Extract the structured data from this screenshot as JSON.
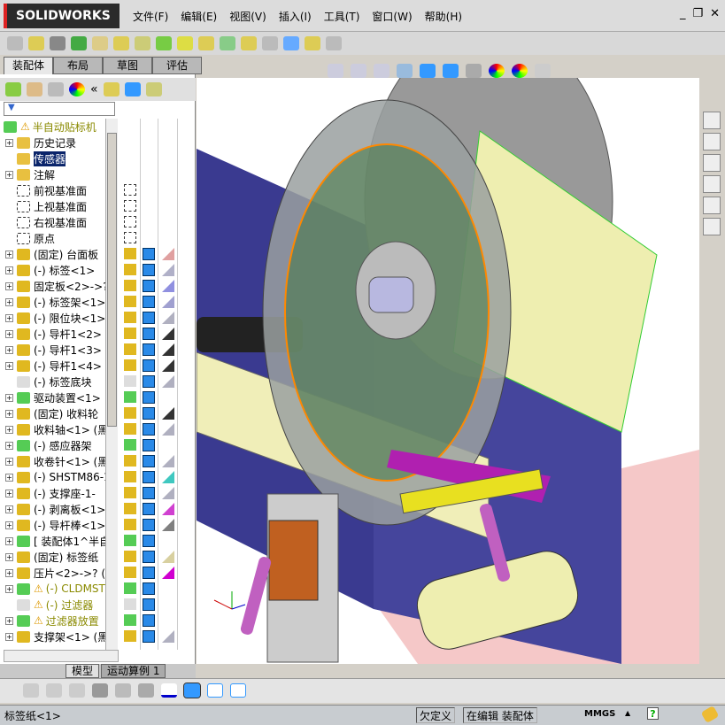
{
  "app": {
    "logo": "SOLIDWORKS",
    "menu": [
      "文件(F)",
      "编辑(E)",
      "视图(V)",
      "插入(I)",
      "工具(T)",
      "窗口(W)",
      "帮助(H)"
    ],
    "window_controls": [
      "minimize",
      "restore",
      "close"
    ]
  },
  "tabs": [
    "装配体",
    "布局",
    "草图",
    "评估"
  ],
  "tree": {
    "root": "半自动贴标机",
    "items": [
      {
        "label": "历史记录",
        "expand": true,
        "icon": "history-folder-icon"
      },
      {
        "label": "传感器",
        "expand": false,
        "icon": "sensor-folder-icon",
        "selected": true
      },
      {
        "label": "注解",
        "expand": true,
        "icon": "annotation-folder-icon"
      },
      {
        "label": "前视基准面",
        "expand": false,
        "icon": "plane-icon"
      },
      {
        "label": "上视基准面",
        "expand": false,
        "icon": "plane-icon"
      },
      {
        "label": "右视基准面",
        "expand": false,
        "icon": "plane-icon"
      },
      {
        "label": "原点",
        "expand": false,
        "icon": "origin-icon"
      },
      {
        "label": "(固定) 台面板",
        "expand": true,
        "icon": "part-icon"
      },
      {
        "label": "(-) 标签<1>",
        "expand": true,
        "icon": "part-icon"
      },
      {
        "label": "固定板<2>->?",
        "expand": true,
        "icon": "part-icon"
      },
      {
        "label": "(-) 标签架<1>",
        "expand": true,
        "icon": "part-icon"
      },
      {
        "label": "(-) 限位块<1>",
        "expand": true,
        "icon": "part-icon"
      },
      {
        "label": "(-) 导杆1<2>",
        "expand": true,
        "icon": "part-icon"
      },
      {
        "label": "(-) 导杆1<3>",
        "expand": true,
        "icon": "part-icon"
      },
      {
        "label": "(-) 导杆1<4>",
        "expand": true,
        "icon": "part-icon"
      },
      {
        "label": "(-) 标签底块",
        "expand": false,
        "icon": "part-suppressed-icon"
      },
      {
        "label": "驱动装置<1>",
        "expand": true,
        "icon": "subassembly-icon"
      },
      {
        "label": "(固定) 收料轮",
        "expand": true,
        "icon": "part-icon"
      },
      {
        "label": "收料轴<1> (黑",
        "expand": true,
        "icon": "part-icon"
      },
      {
        "label": "(-) 感应器架",
        "expand": true,
        "icon": "subassembly-icon"
      },
      {
        "label": "收卷针<1> (黑",
        "expand": true,
        "icon": "part-icon"
      },
      {
        "label": "(-) SHSTM86-1",
        "expand": true,
        "icon": "part-icon"
      },
      {
        "label": "(-) 支撑座-1-",
        "expand": true,
        "icon": "part-icon"
      },
      {
        "label": "(-) 剥离板<1>",
        "expand": true,
        "icon": "part-icon"
      },
      {
        "label": "(-) 导杆棒<1>",
        "expand": true,
        "icon": "part-icon"
      },
      {
        "label": "[ 装配体1^半自",
        "expand": true,
        "icon": "subassembly-icon"
      },
      {
        "label": "(固定) 标签纸",
        "expand": true,
        "icon": "part-icon"
      },
      {
        "label": "压片<2>->? (",
        "expand": true,
        "icon": "part-icon"
      },
      {
        "label": "(-) CLDMST",
        "expand": true,
        "icon": "subassembly-icon",
        "warning": true
      },
      {
        "label": "(-) 过滤器",
        "expand": false,
        "icon": "part-suppressed-icon",
        "warning": true
      },
      {
        "label": "过滤器放置",
        "expand": true,
        "icon": "subassembly-icon",
        "warning": true
      },
      {
        "label": "支撑架<1> (黑",
        "expand": true,
        "icon": "part-icon"
      }
    ]
  },
  "appearance_colors": [
    "",
    "",
    "",
    "",
    "",
    "",
    "",
    "#e0a0a0",
    "#b0b0c8",
    "#9090e0",
    "#a0a0d0",
    "#b0b0c0",
    "#333333",
    "#333333",
    "#333333",
    "#b0b0c0",
    "",
    "#333333",
    "#b0b0c0",
    "",
    "#b0b0c0",
    "#40c8c0",
    "#b0b0c0",
    "#d040d0",
    "#808080",
    "",
    "#d8d0a0",
    "#d000d0",
    "",
    "",
    "",
    "#b0b0c0"
  ],
  "bottom_tabs": [
    "模型",
    "运动算例 1"
  ],
  "status": {
    "left": "标签纸<1>",
    "definition": "欠定义",
    "mode": "在编辑 装配体",
    "units": "MMGS"
  }
}
